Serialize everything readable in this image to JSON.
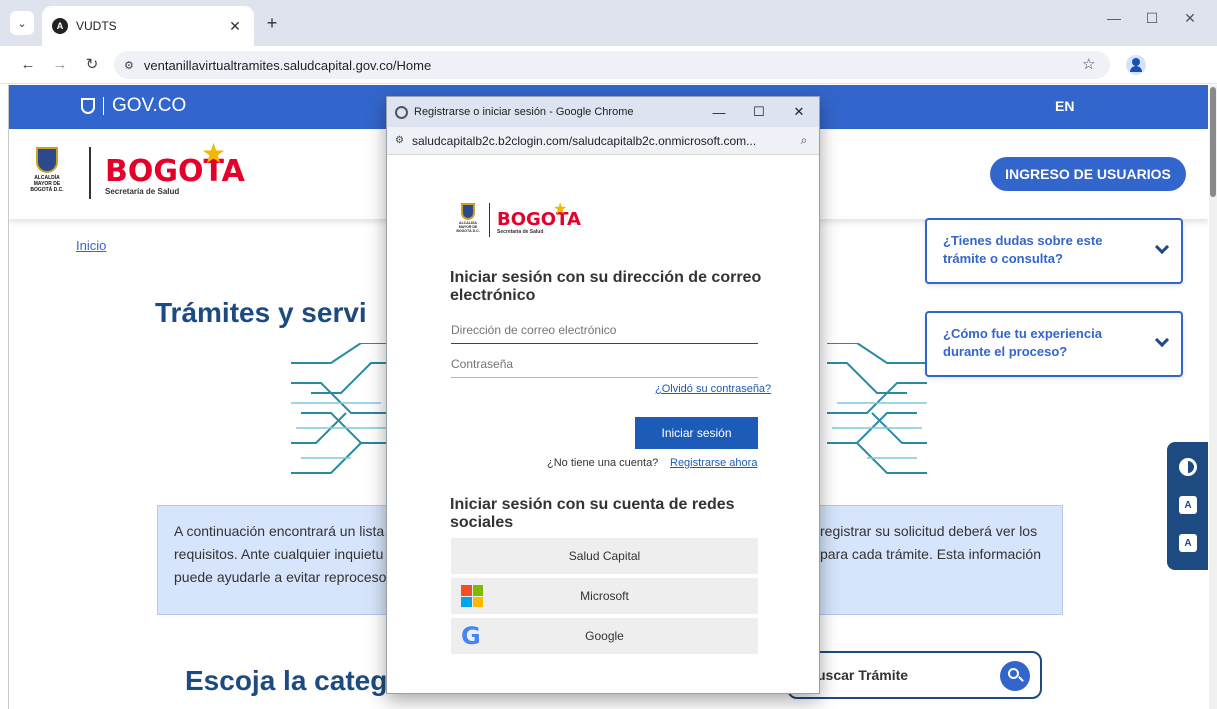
{
  "browser": {
    "tab_title": "VUDTS",
    "tab_favicon": "angular-icon",
    "url": "ventanillavirtualtramites.saludcapital.gov.co/Home",
    "controls": {
      "minimize": "—",
      "maximize": "☐",
      "close": "✕"
    }
  },
  "page": {
    "gov_label": "GOV.CO",
    "lang_label": "EN",
    "escudo_caption": "ALCALDÍA MAYOR DE BOGOTÁ D.C.",
    "brand_word": "BOGOTA",
    "brand_sub": "Secretaría de Salud",
    "login_button": "INGRESO DE USUARIOS",
    "breadcrumb": "Inicio",
    "hero_title": "Trámites y servi",
    "info_left": "A continuación encontrará un lista requisitos. Ante cualquier inquietu puede ayudarle a evitar reproceso",
    "info_right": "registrar su solicitud deberá ver los para cada trámite. Esta información",
    "category_title": "Escoja la categ",
    "search_placeholder": "uscar Trámite",
    "accordions": [
      {
        "question": "¿Tienes dudas sobre este trámite o consulta?"
      },
      {
        "question": "¿Cómo fue tu experiencia durante el proceso?"
      }
    ],
    "accessibility": [
      "contrast-icon",
      "decrease-font-icon",
      "increase-font-icon"
    ],
    "colors": {
      "gov_blue": "#3366cc",
      "navy": "#1d4a80",
      "bogota_red": "#e4002b",
      "info_bg": "#d6e5fb"
    }
  },
  "popup": {
    "window_title": "Registrarse o iniciar sesión - Google Chrome",
    "url": "saludcapitalb2c.b2clogin.com/saludcapitalb2c.onmicrosoft.com...",
    "login_heading": "Iniciar sesión con su dirección de correo electrónico",
    "email_placeholder": "Dirección de correo electrónico",
    "password_placeholder": "Contraseña",
    "forgot_password": "¿Olvidó su contraseña?",
    "submit": "Iniciar sesión",
    "no_account": "¿No tiene una cuenta?",
    "register": "Registrarse ahora",
    "social_heading": "Iniciar sesión con su cuenta de redes sociales",
    "social_providers": [
      {
        "label": "Salud Capital"
      },
      {
        "label": "Microsoft"
      },
      {
        "label": "Google"
      }
    ],
    "colors": {
      "primary": "#1d5bb8"
    }
  }
}
